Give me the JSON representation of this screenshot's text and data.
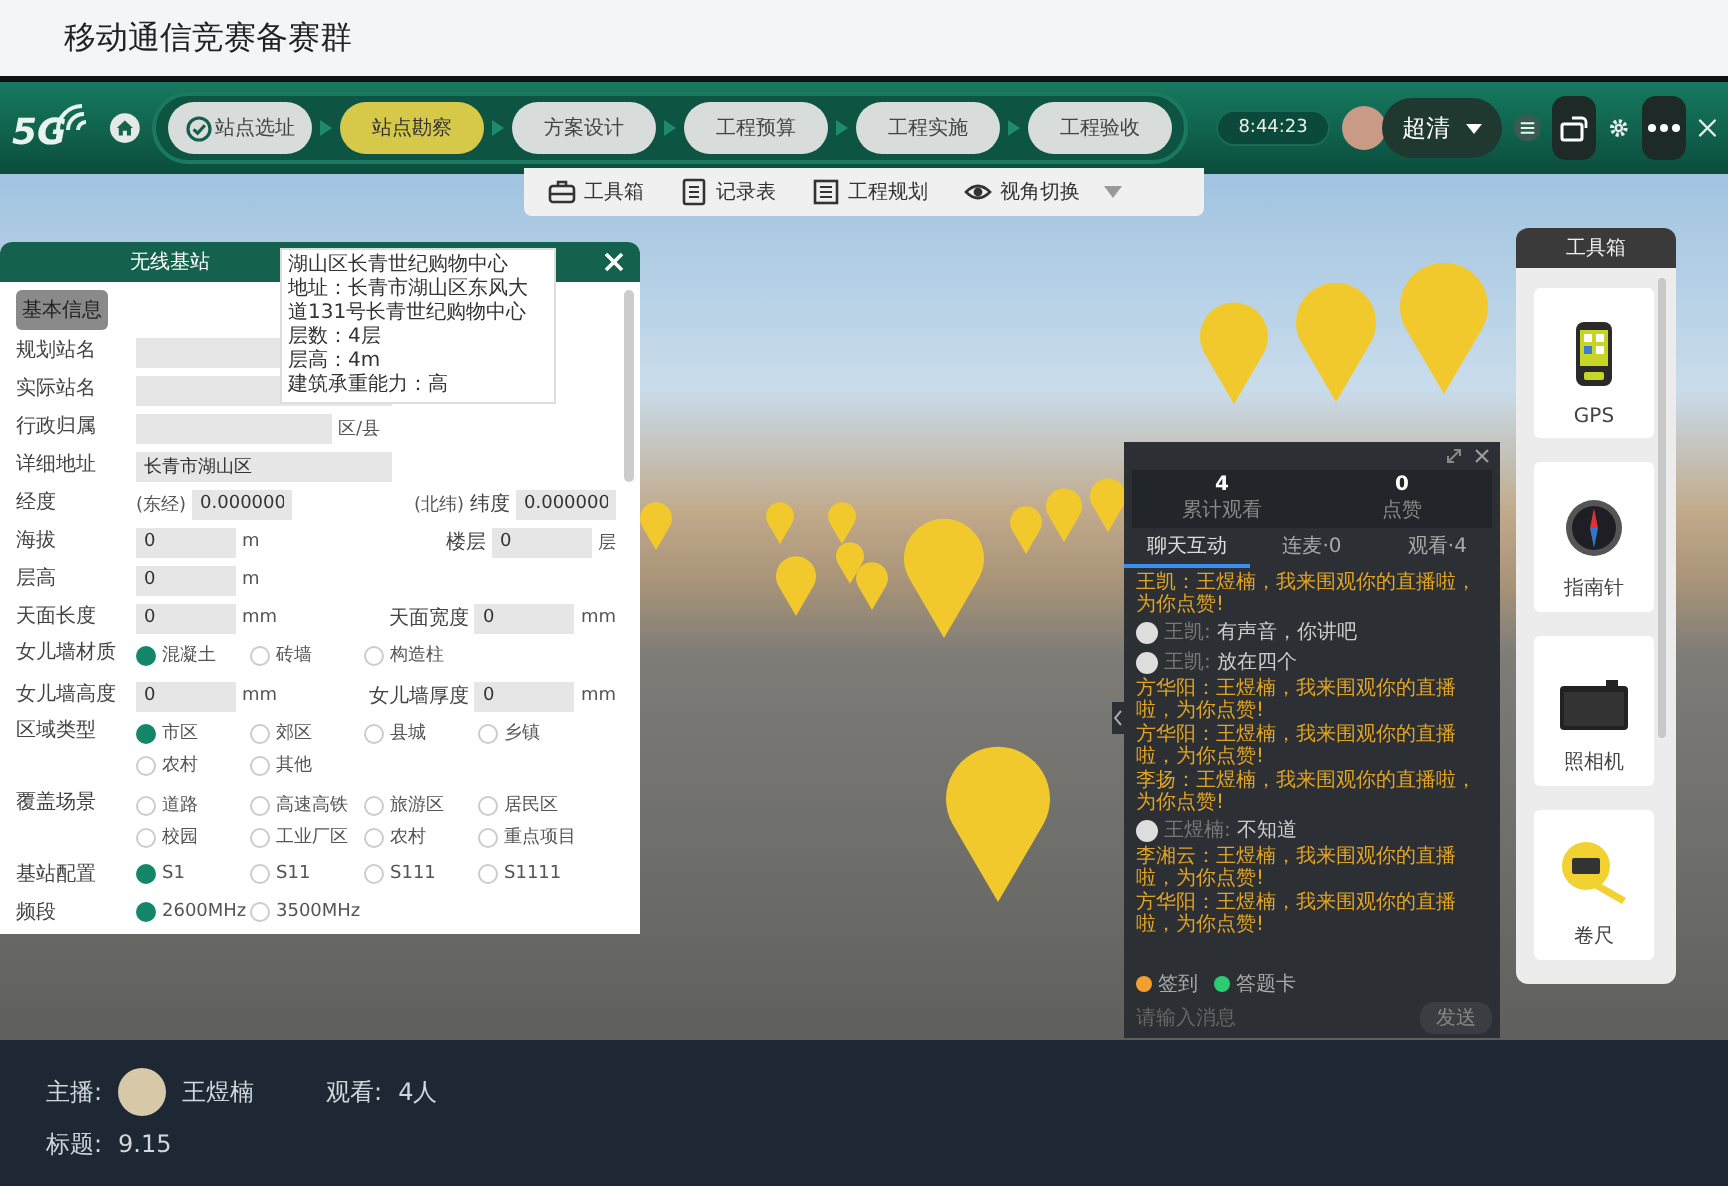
{
  "header": {
    "title": "移动通信竞赛备赛群"
  },
  "navbar": {
    "logo": "5G",
    "steps": [
      {
        "label": "站点选址",
        "selected": false,
        "completed": true
      },
      {
        "label": "站点勘察",
        "selected": true,
        "completed": false
      },
      {
        "label": "方案设计",
        "selected": false,
        "completed": false
      },
      {
        "label": "工程预算",
        "selected": false,
        "completed": false
      },
      {
        "label": "工程实施",
        "selected": false,
        "completed": false
      },
      {
        "label": "工程验收",
        "selected": false,
        "completed": false
      }
    ],
    "time": "8:44:23",
    "quality": "超清"
  },
  "toolbar": [
    {
      "label": "工具箱",
      "kind": "toolbox"
    },
    {
      "label": "记录表",
      "kind": "record"
    },
    {
      "label": "工程规划",
      "kind": "plan"
    },
    {
      "label": "视角切换",
      "kind": "view"
    }
  ],
  "form": {
    "title": "无线基站",
    "section": "基本信息",
    "tooltip": [
      "湖山区长青世纪购物中心",
      "地址：长青市湖山区东风大",
      "道131号长青世纪购物中心",
      "层数：4层",
      "层高：4m",
      "建筑承重能力：高"
    ],
    "rows": [
      {
        "kind": "fields",
        "items": [
          {
            "label": "规划站名",
            "kind": "long"
          }
        ]
      },
      {
        "kind": "fields",
        "items": [
          {
            "label": "实际站名",
            "kind": "long"
          }
        ]
      },
      {
        "kind": "fields",
        "items": [
          {
            "label": "行政归属",
            "kind": "mid",
            "unit": "区/县"
          }
        ]
      },
      {
        "kind": "fields",
        "items": [
          {
            "label": "详细地址",
            "kind": "long",
            "value": "长青市湖山区"
          }
        ]
      },
      {
        "kind": "fields",
        "items": [
          {
            "label": "经度",
            "prefix": "(东经)",
            "kind": "short",
            "value": "0.000000"
          },
          {
            "label": "纬度",
            "prefix": "(北纬)",
            "kind": "short",
            "value": "0.000000"
          }
        ]
      },
      {
        "kind": "fields",
        "items": [
          {
            "label": "海拔",
            "kind": "short",
            "value": "0",
            "unit": "m"
          },
          {
            "label": "楼层",
            "kind": "short",
            "value": "0",
            "unit": "层"
          }
        ]
      },
      {
        "kind": "fields",
        "items": [
          {
            "label": "层高",
            "kind": "short",
            "value": "0",
            "unit": "m"
          }
        ]
      },
      {
        "kind": "fields",
        "items": [
          {
            "label": "天面长度",
            "kind": "short",
            "value": "0",
            "unit": "mm"
          },
          {
            "label": "天面宽度",
            "kind": "short",
            "value": "0",
            "unit": "mm"
          }
        ]
      },
      {
        "kind": "radios",
        "label": "女儿墙材质",
        "options": [
          {
            "label": "混凝土",
            "selected": true
          },
          {
            "label": "砖墙",
            "selected": false
          },
          {
            "label": "构造柱",
            "selected": false
          }
        ]
      },
      {
        "kind": "fields",
        "items": [
          {
            "label": "女儿墙高度",
            "kind": "short",
            "value": "0",
            "unit": "mm"
          },
          {
            "label": "女儿墙厚度",
            "kind": "short",
            "value": "0",
            "unit": "mm"
          }
        ]
      },
      {
        "kind": "radios",
        "label": "区域类型",
        "options": [
          {
            "label": "市区",
            "selected": true
          },
          {
            "label": "郊区",
            "selected": false
          },
          {
            "label": "县城",
            "selected": false
          },
          {
            "label": "乡镇",
            "selected": false
          },
          {
            "label": "农村",
            "selected": false
          },
          {
            "label": "其他",
            "selected": false
          }
        ]
      },
      {
        "kind": "radios",
        "label": "覆盖场景",
        "options": [
          {
            "label": "道路",
            "selected": false
          },
          {
            "label": "高速高铁",
            "selected": false
          },
          {
            "label": "旅游区",
            "selected": false
          },
          {
            "label": "居民区",
            "selected": false
          },
          {
            "label": "校园",
            "selected": false
          },
          {
            "label": "工业厂区",
            "selected": false
          },
          {
            "label": "农村",
            "selected": false
          },
          {
            "label": "重点项目",
            "selected": false
          }
        ]
      },
      {
        "kind": "radios",
        "label": "基站配置",
        "options": [
          {
            "label": "S1",
            "selected": true
          },
          {
            "label": "S11",
            "selected": false
          },
          {
            "label": "S111",
            "selected": false
          },
          {
            "label": "S1111",
            "selected": false
          }
        ]
      },
      {
        "kind": "radios",
        "label": "频段",
        "options": [
          {
            "label": "2600MHz",
            "selected": true
          },
          {
            "label": "3500MHz",
            "selected": false
          }
        ]
      }
    ]
  },
  "chat": {
    "stats": [
      {
        "value": "4",
        "label": "累计观看"
      },
      {
        "value": "0",
        "label": "点赞"
      }
    ],
    "tabs": [
      {
        "label": "聊天互动",
        "selected": true
      },
      {
        "label": "连麦·0",
        "selected": false
      },
      {
        "label": "观看·4",
        "selected": false
      }
    ],
    "messages": [
      {
        "kind": "notice",
        "text": "王凯：王煜楠，我来围观你的直播啦，为你点赞!"
      },
      {
        "kind": "user",
        "name": "王凯:",
        "text": "有声音，你讲吧"
      },
      {
        "kind": "user",
        "name": "王凯:",
        "text": "放在四个"
      },
      {
        "kind": "notice",
        "text": "方华阳：王煜楠，我来围观你的直播啦，为你点赞!"
      },
      {
        "kind": "notice",
        "text": "方华阳：王煜楠，我来围观你的直播啦，为你点赞!"
      },
      {
        "kind": "notice",
        "text": "李扬：王煜楠，我来围观你的直播啦，为你点赞!"
      },
      {
        "kind": "user",
        "name": "王煜楠:",
        "text": "不知道"
      },
      {
        "kind": "notice",
        "text": "李湘云：王煜楠，我来围观你的直播啦，为你点赞!"
      },
      {
        "kind": "notice",
        "text": "方华阳：王煜楠，我来围观你的直播啦，为你点赞!"
      }
    ],
    "actions": [
      {
        "label": "签到",
        "color": "#f0a030"
      },
      {
        "label": "答题卡",
        "color": "#2ecc71"
      }
    ],
    "input": {
      "placeholder": "请输入消息"
    },
    "send": "发送"
  },
  "toolbox": {
    "title": "工具箱",
    "items": [
      {
        "label": "GPS",
        "kind": "gps"
      },
      {
        "label": "指南针",
        "kind": "compass"
      },
      {
        "label": "照相机",
        "kind": "camera"
      },
      {
        "label": "卷尺",
        "kind": "tape"
      }
    ]
  },
  "footer": {
    "host_label": "主播:",
    "host": "王煜楠",
    "viewers_label": "观看:",
    "viewers": "4人",
    "title_label": "标题:",
    "title": "9.15"
  }
}
